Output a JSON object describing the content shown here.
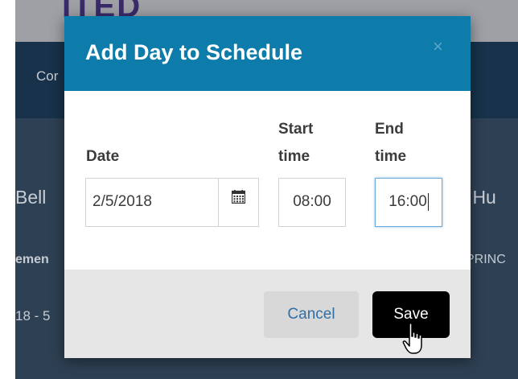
{
  "background": {
    "brand_text": "ITED",
    "nav_item": "Cor",
    "heading_left": "Bell",
    "heading_right": "), Hu",
    "sub_left": "emen",
    "sub_right": "PRINC",
    "date_left": "18 - 5"
  },
  "modal": {
    "title": "Add Day to Schedule",
    "close_glyph": "×",
    "labels": {
      "date": "Date",
      "start_time": "Start\ntime",
      "end_time": "End\ntime"
    },
    "fields": {
      "date_value": "2/5/2018",
      "start_value": "08:00",
      "end_value": "16:00"
    },
    "buttons": {
      "cancel": "Cancel",
      "save": "Save"
    }
  },
  "colors": {
    "header": "#0d7cab",
    "save_button": "#000000",
    "cancel_text": "#2f6fa5"
  },
  "icons": {
    "calendar": "calendar-icon",
    "close": "close-icon",
    "cursor": "hand-pointer-icon"
  }
}
